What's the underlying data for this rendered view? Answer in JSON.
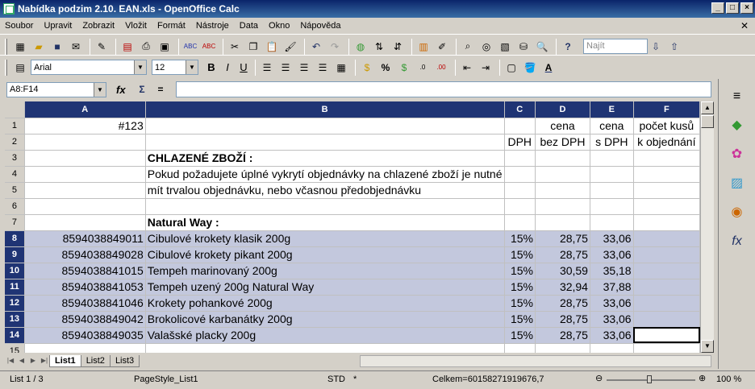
{
  "window": {
    "title": "Nabídka podzim 2.10. EAN.xls - OpenOffice Calc"
  },
  "menu": [
    "Soubor",
    "Upravit",
    "Zobrazit",
    "Vložit",
    "Formát",
    "Nástroje",
    "Data",
    "Okno",
    "Nápověda"
  ],
  "toolbar": {
    "find_placeholder": "Najít"
  },
  "formatting": {
    "font": "Arial",
    "size": "12"
  },
  "formula": {
    "namebox": "A8:F14",
    "content": ""
  },
  "columns": [
    "A",
    "B",
    "C",
    "D",
    "E",
    "F"
  ],
  "rows": [
    {
      "n": "1",
      "a": "#123",
      "b": "",
      "c": "",
      "d": "cena",
      "e": "cena",
      "f": "počet kusů",
      "sel": false
    },
    {
      "n": "2",
      "a": "",
      "b": "",
      "c": "DPH",
      "d": "bez DPH",
      "e": "s DPH",
      "f": "k objednání",
      "sel": false
    },
    {
      "n": "3",
      "a": "",
      "b": "CHLAZENÉ  ZBOŽÍ :",
      "c": "",
      "d": "",
      "e": "",
      "f": "",
      "sel": false,
      "bold": true
    },
    {
      "n": "4",
      "a": "",
      "b": "Pokud požadujete úplné vykrytí objednávky na chlazené zboží je nutné",
      "c": "",
      "d": "",
      "e": "",
      "f": "",
      "sel": false
    },
    {
      "n": "5",
      "a": "",
      "b": "mít trvalou objednávku, nebo včasnou předobjednávku",
      "c": "",
      "d": "",
      "e": "",
      "f": "",
      "sel": false
    },
    {
      "n": "6",
      "a": "",
      "b": "",
      "c": "",
      "d": "",
      "e": "",
      "f": "",
      "sel": false
    },
    {
      "n": "7",
      "a": "",
      "b": "Natural Way :",
      "c": "",
      "d": "",
      "e": "",
      "f": "",
      "sel": false,
      "bold": true
    },
    {
      "n": "8",
      "a": "8594038849011",
      "b": "Cibulové krokety klasik 200g",
      "c": "15%",
      "d": "28,75",
      "e": "33,06",
      "f": "",
      "sel": true
    },
    {
      "n": "9",
      "a": "8594038849028",
      "b": "Cibulové krokety pikant 200g",
      "c": "15%",
      "d": "28,75",
      "e": "33,06",
      "f": "",
      "sel": true
    },
    {
      "n": "10",
      "a": "8594038841015",
      "b": "Tempeh marinovaný 200g",
      "c": "15%",
      "d": "30,59",
      "e": "35,18",
      "f": "",
      "sel": true
    },
    {
      "n": "11",
      "a": "8594038841053",
      "b": "Tempeh uzený 200g Natural Way",
      "c": "15%",
      "d": "32,94",
      "e": "37,88",
      "f": "",
      "sel": true
    },
    {
      "n": "12",
      "a": "8594038841046",
      "b": "Krokety pohankové 200g",
      "c": "15%",
      "d": "28,75",
      "e": "33,06",
      "f": "",
      "sel": true
    },
    {
      "n": "13",
      "a": "8594038849042",
      "b": "Brokolicové karbanátky 200g",
      "c": "15%",
      "d": "28,75",
      "e": "33,06",
      "f": "",
      "sel": true
    },
    {
      "n": "14",
      "a": "8594038849035",
      "b": "Valašské placky 200g",
      "c": "15%",
      "d": "28,75",
      "e": "33,06",
      "f": "",
      "sel": true
    },
    {
      "n": "15",
      "a": "",
      "b": "",
      "c": "",
      "d": "",
      "e": "",
      "f": "",
      "sel": false
    }
  ],
  "tabs": [
    "List1",
    "List2",
    "List3"
  ],
  "status": {
    "sheet": "List 1 / 3",
    "style": "PageStyle_List1",
    "mode": "STD",
    "modified": "*",
    "sum": "Celkem=60158271919676,7",
    "zoom": "100 %"
  }
}
